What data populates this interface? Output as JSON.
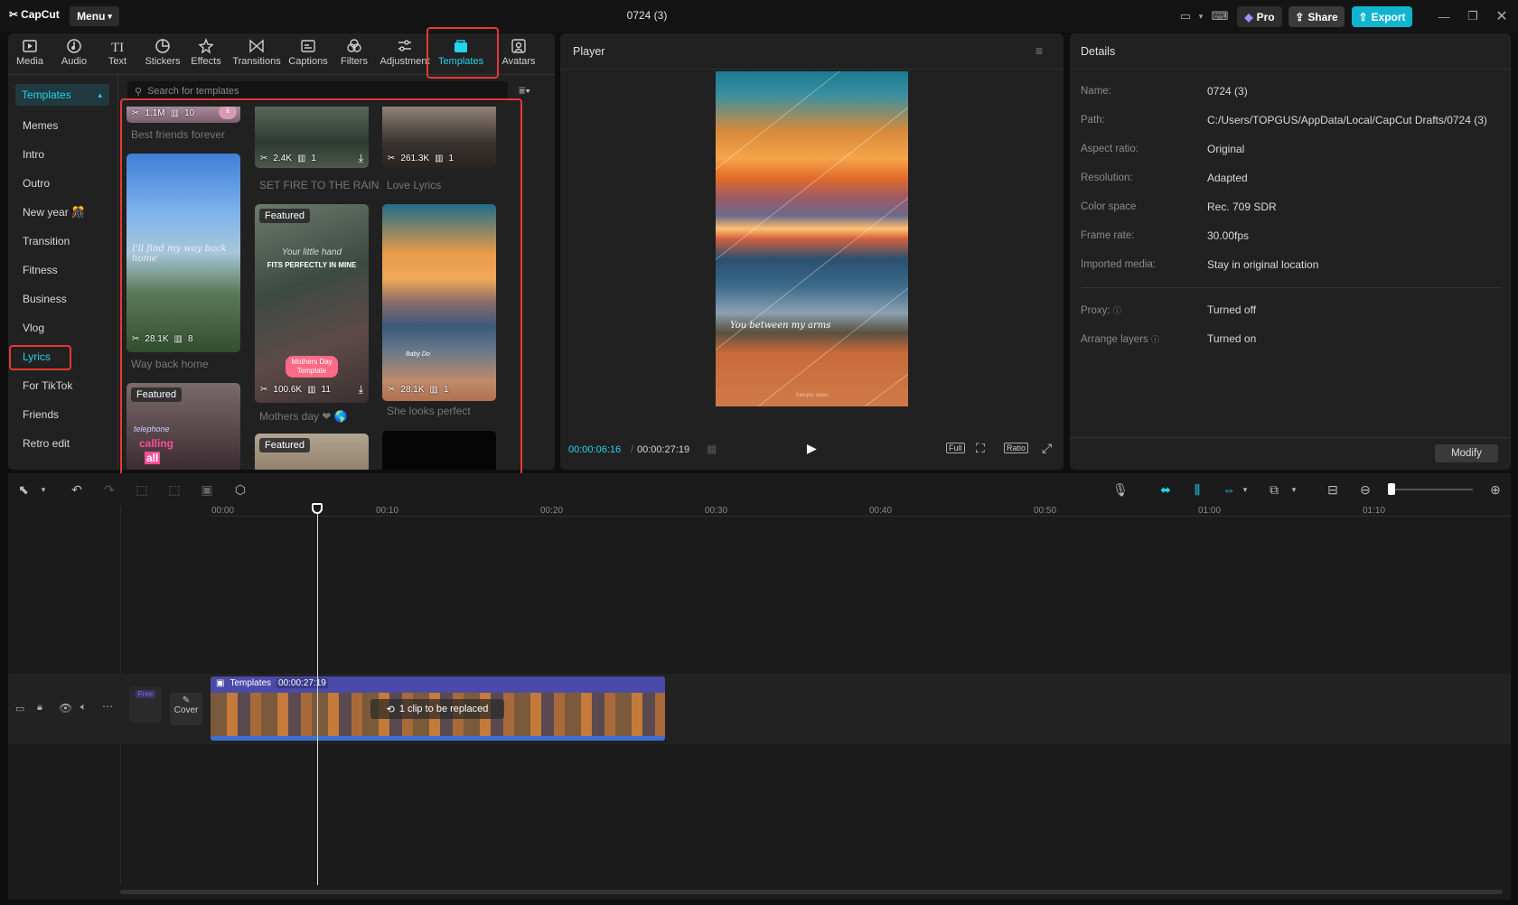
{
  "app": {
    "logo": "CapCut",
    "menu": "Menu",
    "project_title": "0724 (3)",
    "pro": "Pro",
    "share": "Share",
    "export": "Export"
  },
  "toolbar": [
    {
      "id": "media",
      "label": "Media"
    },
    {
      "id": "audio",
      "label": "Audio"
    },
    {
      "id": "text",
      "label": "Text"
    },
    {
      "id": "stickers",
      "label": "Stickers"
    },
    {
      "id": "effects",
      "label": "Effects"
    },
    {
      "id": "transitions",
      "label": "Transitions"
    },
    {
      "id": "captions",
      "label": "Captions"
    },
    {
      "id": "filters",
      "label": "Filters"
    },
    {
      "id": "adjustment",
      "label": "Adjustment"
    },
    {
      "id": "templates",
      "label": "Templates"
    },
    {
      "id": "avatars",
      "label": "Avatars"
    }
  ],
  "sidebar": {
    "active": "Templates",
    "items": [
      "Memes",
      "Intro",
      "Outro",
      "New year 🎊",
      "Transition",
      "Fitness",
      "Business",
      "Vlog",
      "Lyrics",
      "For TikTok",
      "Friends",
      "Retro edit"
    ]
  },
  "search": {
    "placeholder": "Search for templates"
  },
  "templates": [
    {
      "name": "Best friends forever",
      "uses": "1.1M",
      "clips": "10"
    },
    {
      "name": "SET FIRE TO THE RAIN",
      "uses": "2.4K",
      "clips": "1"
    },
    {
      "name": "Love Lyrics",
      "uses": "261.3K",
      "clips": "1"
    },
    {
      "name": "Way back home",
      "uses": "28.1K",
      "clips": "8",
      "overlay": "I'll find my way back home"
    },
    {
      "name": "Mothers day ❤ 🌎",
      "uses": "100.6K",
      "clips": "11",
      "badge": "Featured",
      "overlay1": "Your little hand",
      "overlay2": "FITS PERFECTLY IN MINE",
      "sticker": "Mothers Day Template"
    },
    {
      "name": "She looks perfect",
      "uses": "28.1K",
      "clips": "1",
      "overlay": "Baby Do"
    },
    {
      "badge": "Featured",
      "overlay1": "telephone",
      "overlay2": "calling",
      "overlay3": "all"
    },
    {
      "badge": "Featured"
    }
  ],
  "player": {
    "title": "Player",
    "caption": "You between my arms",
    "watermark": "Sample video",
    "current_time": "00:00:06:16",
    "total_time": "00:00:27:19",
    "full": "Full",
    "ratio": "Ratio"
  },
  "details": {
    "title": "Details",
    "fields": [
      {
        "label": "Name:",
        "value": "0724 (3)"
      },
      {
        "label": "Path:",
        "value": "C:/Users/TOPGUS/AppData/Local/CapCut Drafts/0724 (3)"
      },
      {
        "label": "Aspect ratio:",
        "value": "Original"
      },
      {
        "label": "Resolution:",
        "value": "Adapted"
      },
      {
        "label": "Color space",
        "value": "Rec. 709 SDR"
      },
      {
        "label": "Frame rate:",
        "value": "30.00fps"
      },
      {
        "label": "Imported media:",
        "value": "Stay in original location"
      },
      {
        "label": "Proxy:",
        "value": "Turned off"
      },
      {
        "label": "Arrange layers",
        "value": "Turned on"
      }
    ],
    "modify": "Modify"
  },
  "timeline": {
    "ticks": [
      "00:00",
      "00:10",
      "00:20",
      "00:30",
      "00:40",
      "00:50",
      "01:00",
      "01:10"
    ],
    "track_label": "Templates",
    "track_time": "00:00:27:19",
    "replace": "1 clip to be replaced",
    "cover": "Cover",
    "free": "Free"
  },
  "colors": {
    "accent": "#22d3ee",
    "highlight": "#e53935",
    "track": "#4a4aa8"
  }
}
